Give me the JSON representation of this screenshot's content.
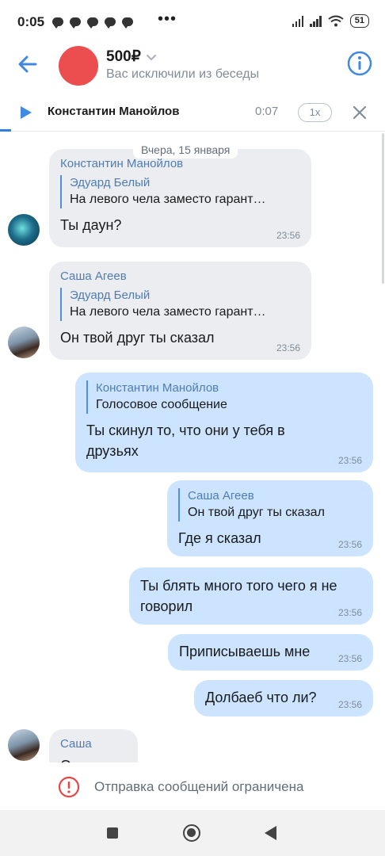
{
  "status_bar": {
    "time": "0:05",
    "battery": "51",
    "more": "•••"
  },
  "header": {
    "title": "500₽",
    "subtitle": "Вас исключили из беседы",
    "avatar_color": "#ec4d4f"
  },
  "audio_player": {
    "name": "Константин Манойлов",
    "time": "0:07",
    "speed": "1x"
  },
  "chat": {
    "date": "Вчера, 15 января",
    "messages": [
      {
        "direction": "in",
        "sender": "Константин Манойлов",
        "quote_name": "Эдуард Белый",
        "quote_text": "На левого чела заместо гарант…",
        "text": "Ты даун?",
        "time": "23:56"
      },
      {
        "direction": "in",
        "sender": "Саша Агеев",
        "quote_name": "Эдуард Белый",
        "quote_text": "На левого чела заместо гарант…",
        "text": "Он твой друг ты сказал",
        "time": "23:56"
      },
      {
        "direction": "out",
        "quote_name": "Константин Манойлов",
        "quote_text": "Голосовое сообщение",
        "text_line1": "Ты скинул то, что они у тебя в",
        "text_line2": "друзьях",
        "time": "23:56"
      },
      {
        "direction": "out",
        "quote_name": "Саша Агеев",
        "quote_text": "Он твой друг ты сказал",
        "text": "Где я сказал",
        "time": "23:56"
      },
      {
        "direction": "out",
        "text_line1": "Ты блять много того чего я не",
        "text_line2": "говорил",
        "time": "23:56"
      },
      {
        "direction": "out",
        "text": "Приписываешь мне",
        "time": "23:56"
      },
      {
        "direction": "out",
        "text": "Долбаеб что ли?",
        "time": "23:56"
      },
      {
        "direction": "in",
        "sender": "Саша",
        "text": "Он"
      }
    ]
  },
  "restriction": {
    "text": "Отправка сообщений ограничена"
  },
  "colors": {
    "accent": "#3f8ae0",
    "incoming_bubble": "#ebedf0",
    "outgoing_bubble": "#cce4ff",
    "warning": "#e64646"
  }
}
